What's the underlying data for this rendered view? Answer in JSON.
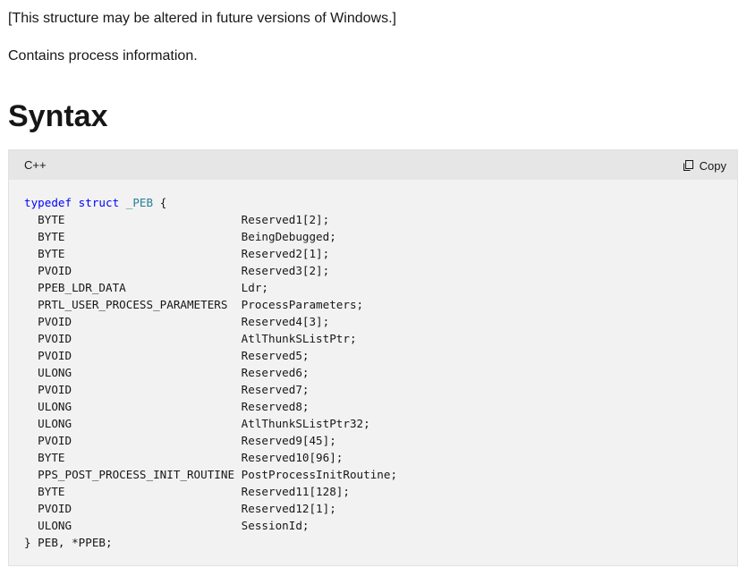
{
  "doc": {
    "note": "[This structure may be altered in future versions of Windows.]",
    "description": "Contains process information.",
    "syntax_heading": "Syntax"
  },
  "code_block": {
    "language": "C++",
    "copy_label": "Copy",
    "header": {
      "kw1": "typedef",
      "kw2": "struct",
      "name": "_PEB",
      "brace": " {"
    },
    "fields": [
      {
        "type": "BYTE",
        "name": "Reserved1[2];"
      },
      {
        "type": "BYTE",
        "name": "BeingDebugged;"
      },
      {
        "type": "BYTE",
        "name": "Reserved2[1];"
      },
      {
        "type": "PVOID",
        "name": "Reserved3[2];"
      },
      {
        "type": "PPEB_LDR_DATA",
        "name": "Ldr;"
      },
      {
        "type": "PRTL_USER_PROCESS_PARAMETERS",
        "name": "ProcessParameters;"
      },
      {
        "type": "PVOID",
        "name": "Reserved4[3];"
      },
      {
        "type": "PVOID",
        "name": "AtlThunkSListPtr;"
      },
      {
        "type": "PVOID",
        "name": "Reserved5;"
      },
      {
        "type": "ULONG",
        "name": "Reserved6;"
      },
      {
        "type": "PVOID",
        "name": "Reserved7;"
      },
      {
        "type": "ULONG",
        "name": "Reserved8;"
      },
      {
        "type": "ULONG",
        "name": "AtlThunkSListPtr32;"
      },
      {
        "type": "PVOID",
        "name": "Reserved9[45];"
      },
      {
        "type": "BYTE",
        "name": "Reserved10[96];"
      },
      {
        "type": "PPS_POST_PROCESS_INIT_ROUTINE",
        "name": "PostProcessInitRoutine;"
      },
      {
        "type": "BYTE",
        "name": "Reserved11[128];"
      },
      {
        "type": "PVOID",
        "name": "Reserved12[1];"
      },
      {
        "type": "ULONG",
        "name": "SessionId;"
      }
    ],
    "footer": "} PEB, *PPEB;"
  }
}
